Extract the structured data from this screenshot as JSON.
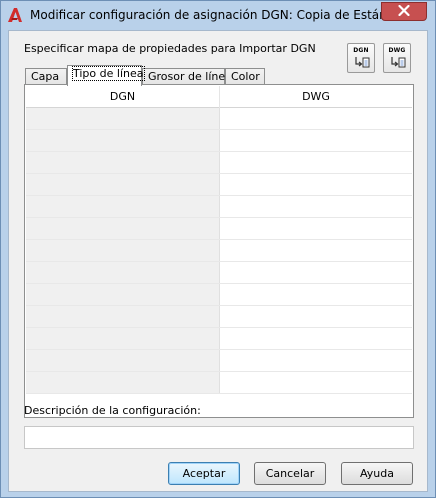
{
  "window": {
    "title": "Modificar configuración de asignación DGN: Copia de Estándar",
    "app_icon": "autocad-icon",
    "close_icon": "close-icon"
  },
  "main": {
    "heading": "Especificar mapa de propiedades para Importar DGN",
    "icon_buttons": [
      {
        "label": "DGN",
        "icon": "dgn-import-icon"
      },
      {
        "label": "DWG",
        "icon": "dwg-import-icon"
      }
    ],
    "tabs": [
      {
        "label": "Capa",
        "active": false
      },
      {
        "label": "Tipo de línea",
        "active": true
      },
      {
        "label": "Grosor de línea",
        "active": false
      },
      {
        "label": "Color",
        "active": false
      }
    ],
    "table": {
      "columns": [
        "DGN",
        "DWG"
      ],
      "rows": [
        [
          "",
          ""
        ],
        [
          "",
          ""
        ],
        [
          "",
          ""
        ],
        [
          "",
          ""
        ],
        [
          "",
          ""
        ],
        [
          "",
          ""
        ],
        [
          "",
          ""
        ],
        [
          "",
          ""
        ],
        [
          "",
          ""
        ],
        [
          "",
          ""
        ],
        [
          "",
          ""
        ],
        [
          "",
          ""
        ],
        [
          "",
          ""
        ]
      ]
    },
    "description_label": "Descripción de la configuración:",
    "description_value": ""
  },
  "footer": {
    "accept_label": "Aceptar",
    "cancel_label": "Cancelar",
    "help_label": "Ayuda"
  },
  "colors": {
    "frame": "#b9d1ea",
    "close_button": "#c75050",
    "app_icon_red": "#d22c2c"
  }
}
